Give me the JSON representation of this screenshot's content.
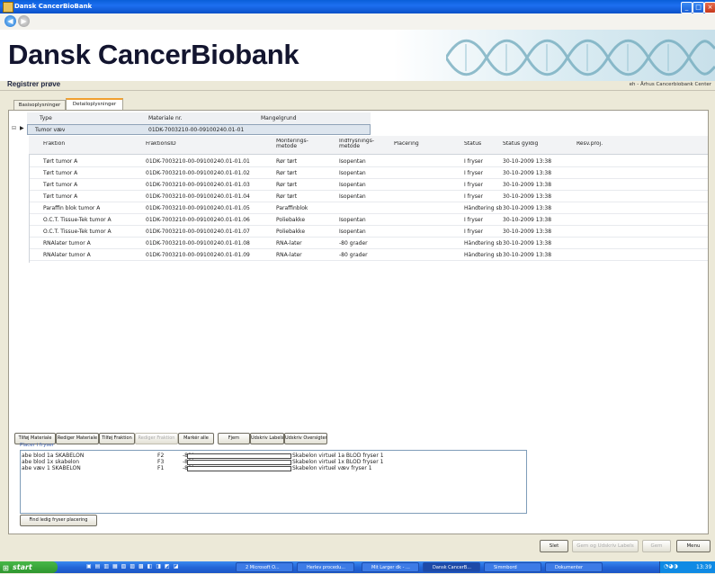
{
  "window": {
    "title": "Dansk CancerBioBank"
  },
  "header": {
    "app_title": "Dansk CancerBiobank",
    "page_title": "Registrer prøve",
    "center": "eh - Århus Cancerbiobank Center"
  },
  "tabs": [
    {
      "label": "Basisoplysninger"
    },
    {
      "label": "Detailoplysninger"
    }
  ],
  "parent_table": {
    "columns": [
      "Type",
      "Materiale nr.",
      "Mangelgrund"
    ],
    "row": {
      "type": "Tumor væv",
      "material_nr": "01DK-7003210-00-09100240.01-01",
      "reason": ""
    }
  },
  "fraction_table": {
    "columns": [
      "Fraktion",
      "FraktionsID",
      "Monterings-\nmetode",
      "Indfrysnings-\nmetode",
      "Placering",
      "Status",
      "Status gyldig",
      "Resv.proj."
    ],
    "rows": [
      [
        "Tørt tumor A",
        "01DK-7003210-00-09100240.01-01.01",
        "Rør tørt",
        "Isopentan",
        "",
        "I fryser",
        "30-10-2009 13:38",
        ""
      ],
      [
        "Tørt tumor A",
        "01DK-7003210-00-09100240.01-01.02",
        "Rør tørt",
        "Isopentan",
        "",
        "I fryser",
        "30-10-2009 13:38",
        ""
      ],
      [
        "Tørt tumor A",
        "01DK-7003210-00-09100240.01-01.03",
        "Rør tørt",
        "Isopentan",
        "",
        "I fryser",
        "30-10-2009 13:38",
        ""
      ],
      [
        "Tørt tumor A",
        "01DK-7003210-00-09100240.01-01.04",
        "Rør tørt",
        "Isopentan",
        "",
        "I fryser",
        "30-10-2009 13:38",
        ""
      ],
      [
        "Paraffin blok tumor A",
        "01DK-7003210-00-09100240.01-01.05",
        "Paraffinblok",
        "",
        "",
        "Håndtering sb",
        "30-10-2009 13:38",
        ""
      ],
      [
        "O.C.T. Tissue-Tek tumor A",
        "01DK-7003210-00-09100240.01-01.06",
        "Poliebakke",
        "Isopentan",
        "",
        "I fryser",
        "30-10-2009 13:38",
        ""
      ],
      [
        "O.C.T. Tissue-Tek tumor A",
        "01DK-7003210-00-09100240.01-01.07",
        "Poliebakke",
        "Isopentan",
        "",
        "I fryser",
        "30-10-2009 13:38",
        ""
      ],
      [
        "RNAlater tumor A",
        "01DK-7003210-00-09100240.01-01.08",
        "RNA-later",
        "-80 grader",
        "",
        "Håndtering sb",
        "30-10-2009 13:38",
        ""
      ],
      [
        "RNAlater tumor A",
        "01DK-7003210-00-09100240.01-01.09",
        "RNA-later",
        "-80 grader",
        "",
        "Håndtering sb",
        "30-10-2009 13:38",
        ""
      ]
    ]
  },
  "actions": [
    {
      "label": "Tilføj Materiale",
      "enabled": true
    },
    {
      "label": "Rediger Materiale",
      "enabled": true
    },
    {
      "label": "Tilføj Fraktion",
      "enabled": true
    },
    {
      "label": "Rediger Fraktion",
      "enabled": false
    },
    {
      "label": "Markér alle",
      "enabled": true
    },
    {
      "label": "Fjern",
      "enabled": true
    },
    {
      "label": "Udskriv Labels",
      "enabled": true
    },
    {
      "label": "Udskriv Oversigten",
      "enabled": true
    }
  ],
  "freezer": {
    "legend": "Placer i fryser",
    "rows": [
      {
        "name": "abe blod 1a SKABELON",
        "code": "F2",
        "temp": "-80°",
        "desc": "Skabelon virtuel 1a BLOD fryser 1"
      },
      {
        "name": "abe blod 1x skabelon",
        "code": "F3",
        "temp": "-80°",
        "desc": "Skabelon virtuel 1x BLOD fryser 1"
      },
      {
        "name": "abe væv  1 SKABELON",
        "code": "F1",
        "temp": "-80°",
        "desc": "Skabelon virtuel væv fryser 1"
      }
    ],
    "find_button": "Find ledig fryser placering"
  },
  "footer_buttons": [
    {
      "label": "Slet",
      "enabled": true
    },
    {
      "label": "Gem og Udskriv Labels",
      "enabled": false
    },
    {
      "label": "Gem",
      "enabled": false
    },
    {
      "label": "Menu",
      "enabled": true
    }
  ],
  "taskbar": {
    "start": "start",
    "tasks": [
      "2 Microsoft O...",
      "Herlev procedu...",
      "Mit Larger dk - ...",
      "Dansk CancerB...",
      "Simmbord",
      "Dokumenter"
    ],
    "clock": "13:39"
  },
  "colors": {
    "titlebar": "#0a5fd8",
    "banner_text": "#13152f",
    "tab_accent": "#f0a030",
    "taskbar": "#2466d8",
    "start": "#2e962e"
  }
}
